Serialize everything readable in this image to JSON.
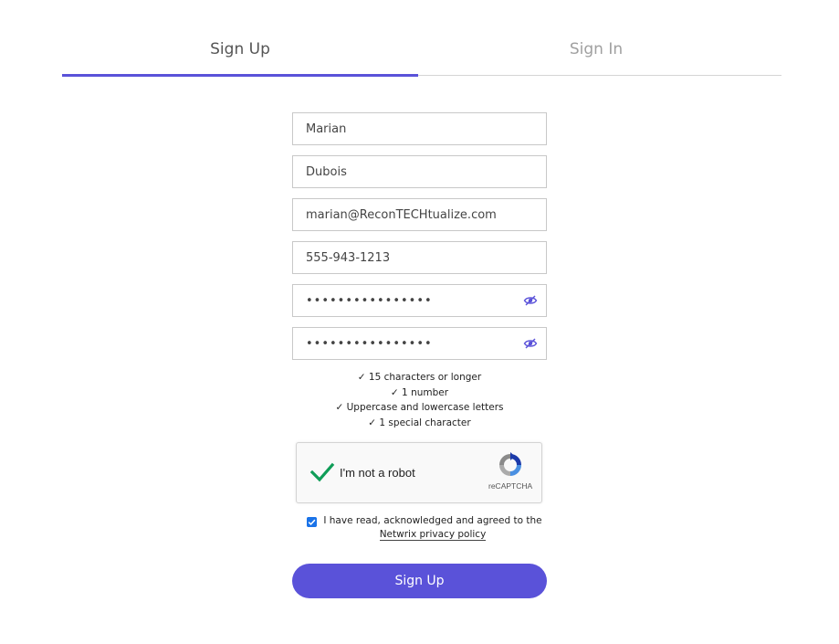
{
  "colors": {
    "accent": "#5a52d9",
    "captcha_check": "#0f9d58",
    "checkbox": "#1a73e8"
  },
  "tabs": [
    {
      "label": "Sign Up",
      "active": true
    },
    {
      "label": "Sign In",
      "active": false
    }
  ],
  "form": {
    "first_name": "Marian",
    "last_name": "Dubois",
    "email": "marian@ReconTECHtualize.com",
    "phone": "555-943-1213",
    "password": "••••••••••••••••",
    "confirm_password": "••••••••••••••••",
    "password_icon": "eye-slash-icon"
  },
  "password_rules": [
    "✓ 15 characters or longer",
    "✓ 1 number",
    "✓ Uppercase and lowercase letters",
    "✓ 1 special character"
  ],
  "captcha": {
    "label": "I'm not a robot",
    "brand": "reCAPTCHA",
    "checked": true
  },
  "consent": {
    "checked": true,
    "text": "I have read, acknowledged and agreed to the",
    "link_text": "Netwrix privacy policy"
  },
  "submit_label": "Sign Up"
}
